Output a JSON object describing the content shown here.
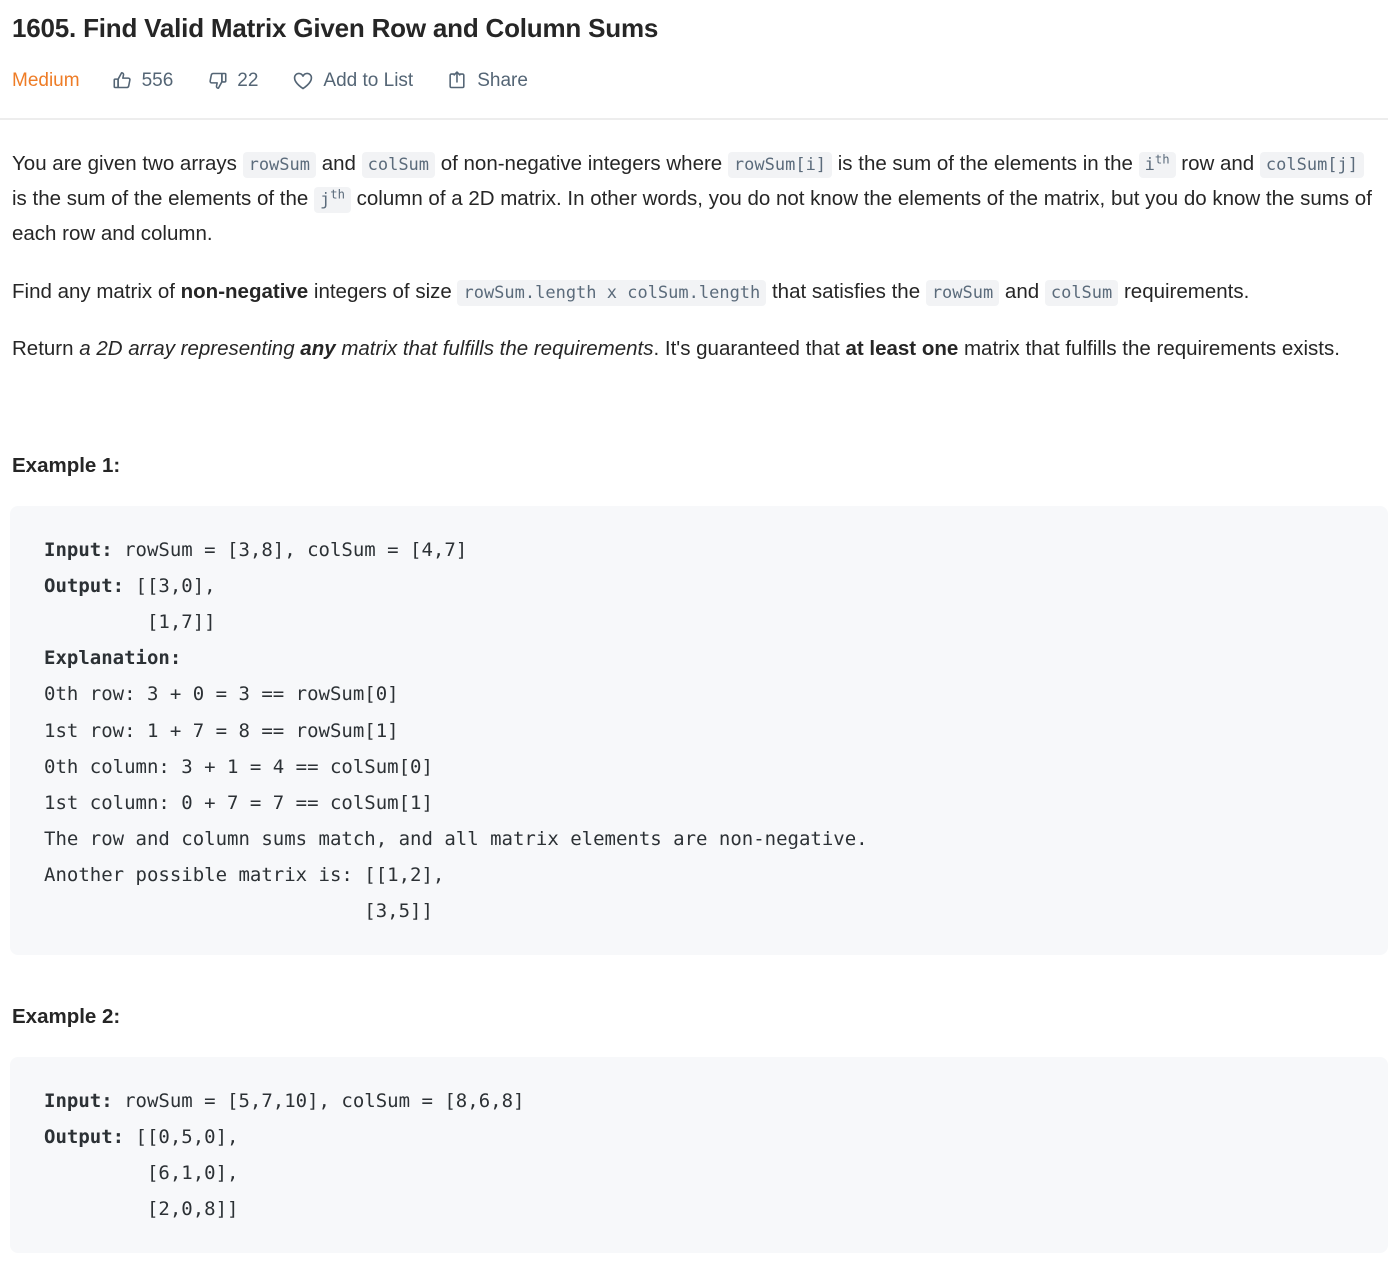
{
  "problem": {
    "title": "1605. Find Valid Matrix Given Row and Column Sums",
    "difficulty": "Medium",
    "difficulty_color": "#ee7c26",
    "likes": "556",
    "dislikes": "22",
    "add_to_list_label": "Add to List",
    "share_label": "Share",
    "icons": {
      "like": "thumbs-up-icon",
      "dislike": "thumbs-down-icon",
      "add_to_list": "heart-icon",
      "share": "share-box-icon"
    }
  },
  "description": {
    "p1": {
      "t1": "You are given two arrays ",
      "c1": "rowSum",
      "t2": " and ",
      "c2": "colSum",
      "t3": " of non-negative integers where ",
      "c3": "rowSum[i]",
      "t4": " is the sum of the elements in the ",
      "c4_base": "i",
      "c4_sup": "th",
      "t5": " row and ",
      "c5": "colSum[j]",
      "t6": " is the sum of the elements of the ",
      "c6_base": "j",
      "c6_sup": "th",
      "t7": " column of a 2D matrix. In other words, you do not know the elements of the matrix, but you do know the sums of each row and column."
    },
    "p2": {
      "t1": "Find any matrix of ",
      "b1": "non-negative",
      "t2": " integers of size ",
      "c1": "rowSum.length x colSum.length",
      "t3": " that satisfies the ",
      "c2": "rowSum",
      "t4": " and ",
      "c3": "colSum",
      "t5": " requirements."
    },
    "p3": {
      "t1": "Return ",
      "i1": "a 2D array representing ",
      "ib1": "any",
      "i2": " matrix that fulfills the requirements",
      "t2": ". It's guaranteed that ",
      "b1": "at least one",
      "t3": " matrix that fulfills the requirements exists."
    }
  },
  "examples": [
    {
      "heading": "Example 1:",
      "lines": [
        {
          "label": "Input:",
          "text": " rowSum = [3,8], colSum = [4,7]"
        },
        {
          "label": "Output:",
          "text": " [[3,0],"
        },
        {
          "label": "",
          "text": "         [1,7]]"
        },
        {
          "label": "Explanation:",
          "text": ""
        },
        {
          "label": "",
          "text": "0th row: 3 + 0 = 3 == rowSum[0]"
        },
        {
          "label": "",
          "text": "1st row: 1 + 7 = 8 == rowSum[1]"
        },
        {
          "label": "",
          "text": "0th column: 3 + 1 = 4 == colSum[0]"
        },
        {
          "label": "",
          "text": "1st column: 0 + 7 = 7 == colSum[1]"
        },
        {
          "label": "",
          "text": "The row and column sums match, and all matrix elements are non-negative."
        },
        {
          "label": "",
          "text": "Another possible matrix is: [[1,2],"
        },
        {
          "label": "",
          "text": "                            [3,5]]"
        }
      ]
    },
    {
      "heading": "Example 2:",
      "lines": [
        {
          "label": "Input:",
          "text": " rowSum = [5,7,10], colSum = [8,6,8]"
        },
        {
          "label": "Output:",
          "text": " [[0,5,0],"
        },
        {
          "label": "",
          "text": "         [6,1,0],"
        },
        {
          "label": "",
          "text": "         [2,0,8]]"
        }
      ]
    }
  ]
}
